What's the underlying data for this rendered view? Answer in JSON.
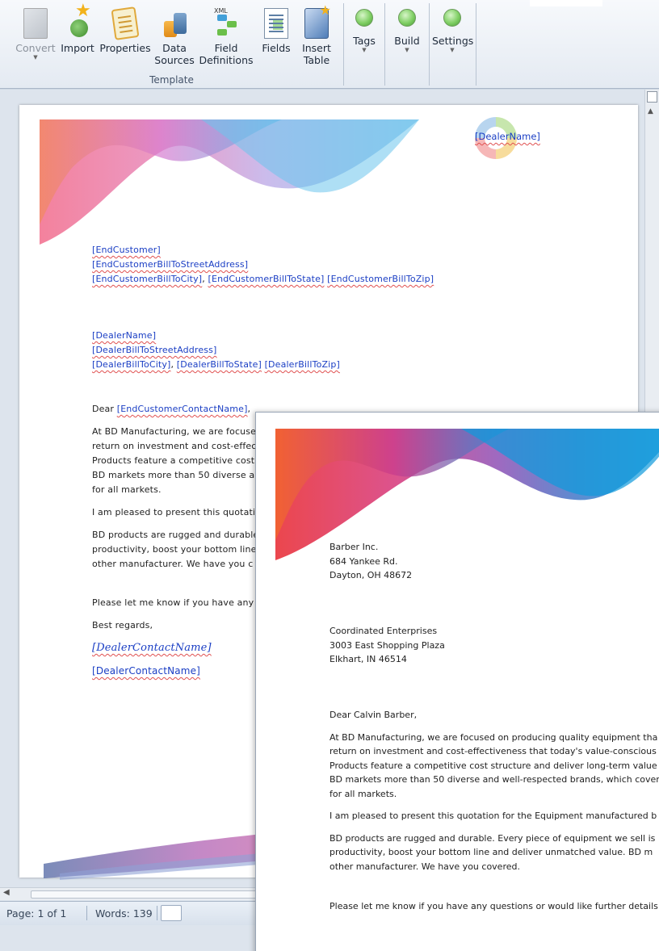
{
  "ribbon": {
    "buttons": [
      {
        "label1": "Convert",
        "label2": "",
        "disabled": true
      },
      {
        "label1": "Import",
        "label2": ""
      },
      {
        "label1": "Properties",
        "label2": ""
      },
      {
        "label1": "Data",
        "label2": "Sources"
      },
      {
        "label1": "Field",
        "label2": "Definitions"
      },
      {
        "label1": "Fields",
        "label2": ""
      },
      {
        "label1": "Insert",
        "label2": "Table"
      }
    ],
    "xml_badge": "XML",
    "group_label": "Template",
    "tags_label": "Tags",
    "build_label": "Build",
    "settings_label": "Settings"
  },
  "template_doc": {
    "logo_text": "[DealerName]",
    "customer_block": {
      "line1": "[EndCustomer]",
      "line2": "[EndCustomerBillToStreetAddress]",
      "line3_city": "[EndCustomerBillToCity]",
      "line3_sep": ", ",
      "line3_state": "[EndCustomerBillToState]",
      "line3_zip": "[EndCustomerBillToZip]"
    },
    "dealer_block": {
      "line1": "[DealerName]",
      "line2": "[DealerBillToStreetAddress]",
      "line3_city": "[DealerBillToCity]",
      "line3_sep": ", ",
      "line3_state": "[DealerBillToState]",
      "line3_zip": "[DealerBillToZip]"
    },
    "greeting_prefix": "Dear ",
    "greeting_field": "[EndCustomerContactName]",
    "greeting_suffix": ",",
    "para1_lines": [
      "At BD Manufacturing, we are focuse",
      "return on investment and cost-effec",
      "Products feature a competitive cost",
      "BD markets more than 50 diverse ar",
      "for all markets."
    ],
    "para2": "I am pleased to present this quotati",
    "para3_lines": [
      "BD products are rugged and durable",
      "productivity, boost your bottom line",
      "other manufacturer.  We have you c"
    ],
    "closing_line": "Please let me know if you have any c",
    "regards": "Best regards,",
    "signature_script": "[DealerContactName]",
    "signature_name": "[DealerContactName]"
  },
  "status_bar": {
    "page": "Page: 1 of 1",
    "words": "Words: 139"
  },
  "output_doc": {
    "customer": [
      "Barber Inc.",
      "684 Yankee Rd.",
      "Dayton, OH  48672"
    ],
    "dealer": [
      "Coordinated Enterprises",
      "3003 East Shopping Plaza",
      "Elkhart, IN  46514"
    ],
    "greeting": "Dear Calvin Barber,",
    "para1_lines": [
      "At BD Manufacturing, we are focused on producing quality equipment tha",
      "return on investment and cost-effectiveness that today's value-conscious",
      "Products feature a competitive cost structure and deliver long-term value",
      "BD markets more than 50 diverse and well-respected brands, which cover",
      "for all markets."
    ],
    "para2": "I am pleased to present this quotation for the Equipment manufactured b",
    "para3_lines": [
      "BD products are rugged and durable.  Every piece of equipment we sell is",
      "productivity, boost your bottom line and deliver unmatched value.  BD m",
      "other manufacturer.  We have you covered."
    ],
    "closing_line": "Please let me know if you have any questions or would like further details"
  }
}
